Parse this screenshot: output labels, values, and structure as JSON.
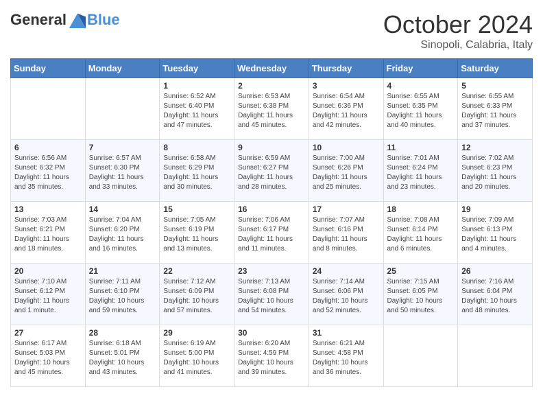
{
  "header": {
    "logo_general": "General",
    "logo_blue": "Blue",
    "month": "October 2024",
    "location": "Sinopoli, Calabria, Italy"
  },
  "weekdays": [
    "Sunday",
    "Monday",
    "Tuesday",
    "Wednesday",
    "Thursday",
    "Friday",
    "Saturday"
  ],
  "weeks": [
    [
      {
        "day": "",
        "info": ""
      },
      {
        "day": "",
        "info": ""
      },
      {
        "day": "1",
        "info": "Sunrise: 6:52 AM\nSunset: 6:40 PM\nDaylight: 11 hours and 47 minutes."
      },
      {
        "day": "2",
        "info": "Sunrise: 6:53 AM\nSunset: 6:38 PM\nDaylight: 11 hours and 45 minutes."
      },
      {
        "day": "3",
        "info": "Sunrise: 6:54 AM\nSunset: 6:36 PM\nDaylight: 11 hours and 42 minutes."
      },
      {
        "day": "4",
        "info": "Sunrise: 6:55 AM\nSunset: 6:35 PM\nDaylight: 11 hours and 40 minutes."
      },
      {
        "day": "5",
        "info": "Sunrise: 6:55 AM\nSunset: 6:33 PM\nDaylight: 11 hours and 37 minutes."
      }
    ],
    [
      {
        "day": "6",
        "info": "Sunrise: 6:56 AM\nSunset: 6:32 PM\nDaylight: 11 hours and 35 minutes."
      },
      {
        "day": "7",
        "info": "Sunrise: 6:57 AM\nSunset: 6:30 PM\nDaylight: 11 hours and 33 minutes."
      },
      {
        "day": "8",
        "info": "Sunrise: 6:58 AM\nSunset: 6:29 PM\nDaylight: 11 hours and 30 minutes."
      },
      {
        "day": "9",
        "info": "Sunrise: 6:59 AM\nSunset: 6:27 PM\nDaylight: 11 hours and 28 minutes."
      },
      {
        "day": "10",
        "info": "Sunrise: 7:00 AM\nSunset: 6:26 PM\nDaylight: 11 hours and 25 minutes."
      },
      {
        "day": "11",
        "info": "Sunrise: 7:01 AM\nSunset: 6:24 PM\nDaylight: 11 hours and 23 minutes."
      },
      {
        "day": "12",
        "info": "Sunrise: 7:02 AM\nSunset: 6:23 PM\nDaylight: 11 hours and 20 minutes."
      }
    ],
    [
      {
        "day": "13",
        "info": "Sunrise: 7:03 AM\nSunset: 6:21 PM\nDaylight: 11 hours and 18 minutes."
      },
      {
        "day": "14",
        "info": "Sunrise: 7:04 AM\nSunset: 6:20 PM\nDaylight: 11 hours and 16 minutes."
      },
      {
        "day": "15",
        "info": "Sunrise: 7:05 AM\nSunset: 6:19 PM\nDaylight: 11 hours and 13 minutes."
      },
      {
        "day": "16",
        "info": "Sunrise: 7:06 AM\nSunset: 6:17 PM\nDaylight: 11 hours and 11 minutes."
      },
      {
        "day": "17",
        "info": "Sunrise: 7:07 AM\nSunset: 6:16 PM\nDaylight: 11 hours and 8 minutes."
      },
      {
        "day": "18",
        "info": "Sunrise: 7:08 AM\nSunset: 6:14 PM\nDaylight: 11 hours and 6 minutes."
      },
      {
        "day": "19",
        "info": "Sunrise: 7:09 AM\nSunset: 6:13 PM\nDaylight: 11 hours and 4 minutes."
      }
    ],
    [
      {
        "day": "20",
        "info": "Sunrise: 7:10 AM\nSunset: 6:12 PM\nDaylight: 11 hours and 1 minute."
      },
      {
        "day": "21",
        "info": "Sunrise: 7:11 AM\nSunset: 6:10 PM\nDaylight: 10 hours and 59 minutes."
      },
      {
        "day": "22",
        "info": "Sunrise: 7:12 AM\nSunset: 6:09 PM\nDaylight: 10 hours and 57 minutes."
      },
      {
        "day": "23",
        "info": "Sunrise: 7:13 AM\nSunset: 6:08 PM\nDaylight: 10 hours and 54 minutes."
      },
      {
        "day": "24",
        "info": "Sunrise: 7:14 AM\nSunset: 6:06 PM\nDaylight: 10 hours and 52 minutes."
      },
      {
        "day": "25",
        "info": "Sunrise: 7:15 AM\nSunset: 6:05 PM\nDaylight: 10 hours and 50 minutes."
      },
      {
        "day": "26",
        "info": "Sunrise: 7:16 AM\nSunset: 6:04 PM\nDaylight: 10 hours and 48 minutes."
      }
    ],
    [
      {
        "day": "27",
        "info": "Sunrise: 6:17 AM\nSunset: 5:03 PM\nDaylight: 10 hours and 45 minutes."
      },
      {
        "day": "28",
        "info": "Sunrise: 6:18 AM\nSunset: 5:01 PM\nDaylight: 10 hours and 43 minutes."
      },
      {
        "day": "29",
        "info": "Sunrise: 6:19 AM\nSunset: 5:00 PM\nDaylight: 10 hours and 41 minutes."
      },
      {
        "day": "30",
        "info": "Sunrise: 6:20 AM\nSunset: 4:59 PM\nDaylight: 10 hours and 39 minutes."
      },
      {
        "day": "31",
        "info": "Sunrise: 6:21 AM\nSunset: 4:58 PM\nDaylight: 10 hours and 36 minutes."
      },
      {
        "day": "",
        "info": ""
      },
      {
        "day": "",
        "info": ""
      }
    ]
  ]
}
